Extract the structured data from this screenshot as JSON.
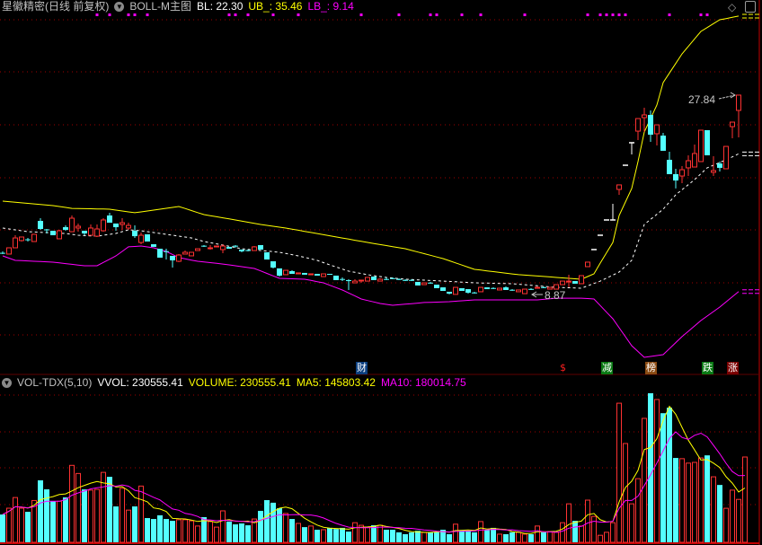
{
  "header": {
    "title": "星徽精密(日线 前复权)",
    "indicator": "BOLL-M主图",
    "bl": "BL: 22.30",
    "ub": "UB_: 35.46",
    "lb": "LB_: 9.14"
  },
  "volume_header": {
    "indicator": "VOL-TDX(5,10)",
    "vvol": "VVOL: 230555.41",
    "volume": "VOLUME: 230555.41",
    "ma5": "MA5: 145803.42",
    "ma10": "MA10: 180014.75"
  },
  "annotations": {
    "high_label": "27.84",
    "low_label": "8.87"
  },
  "icons": {
    "top_right": [
      "diamond-icon",
      "panel-toggle-icon"
    ],
    "collapse": "chevron-down-circle-icon"
  },
  "colors": {
    "up": "#ff3232",
    "down": "#54ffff",
    "flat": "#ffffff",
    "ub": "#ffff00",
    "mid": "#ffffff",
    "lb": "#ff00ff",
    "grid": "#a00000",
    "ma5": "#ffff00",
    "ma10": "#ff00ff"
  },
  "events": [
    {
      "label": "财",
      "index": 57,
      "bg": "#0b3f80",
      "fg": "#ffffff"
    },
    {
      "label": "$",
      "index": 89,
      "bg": "transparent",
      "fg": "#ff2020"
    },
    {
      "label": "减",
      "index": 96,
      "bg": "#0a7a14",
      "fg": "#ffffff"
    },
    {
      "label": "榜",
      "index": 103,
      "bg": "#8a4a12",
      "fg": "#ffffff"
    },
    {
      "label": "跌",
      "index": 112,
      "bg": "#0a7a14",
      "fg": "#ffffff"
    },
    {
      "label": "涨",
      "index": 116,
      "bg": "#7a0000",
      "fg": "#ffffff"
    }
  ],
  "chart_data": {
    "type": "candlestick",
    "candle_fields": [
      "open",
      "close",
      "high",
      "low"
    ],
    "candles": [
      [
        12.84,
        12.8,
        12.98,
        12.72
      ],
      [
        12.72,
        13.32,
        13.32,
        12.72
      ],
      [
        13.32,
        14.26,
        14.52,
        13.32
      ],
      [
        14.01,
        14.35,
        14.35,
        13.92
      ],
      [
        14.13,
        14.09,
        14.26,
        13.92
      ],
      [
        13.92,
        14.61,
        14.61,
        13.92
      ],
      [
        15.89,
        15.12,
        16.15,
        15.04
      ],
      [
        15.08,
        15.04,
        15.12,
        14.69
      ],
      [
        14.95,
        14.52,
        14.95,
        14.52
      ],
      [
        14.18,
        14.95,
        15.04,
        14.18
      ],
      [
        15.29,
        15.04,
        15.46,
        14.95
      ],
      [
        14.86,
        16.15,
        16.41,
        14.86
      ],
      [
        15.21,
        15.38,
        15.64,
        14.86
      ],
      [
        14.95,
        14.69,
        14.95,
        14.52
      ],
      [
        14.52,
        15.21,
        15.55,
        14.52
      ],
      [
        14.43,
        15.12,
        15.55,
        14.35
      ],
      [
        14.95,
        15.98,
        16.15,
        14.86
      ],
      [
        16.41,
        15.72,
        16.67,
        15.72
      ],
      [
        15.64,
        15.29,
        15.64,
        14.95
      ],
      [
        15.55,
        15.72,
        16.15,
        15.04
      ],
      [
        15.21,
        15.46,
        15.72,
        15.04
      ],
      [
        14.95,
        14.43,
        15.46,
        14.26
      ],
      [
        13.83,
        14.52,
        14.78,
        13.66
      ],
      [
        14.61,
        13.92,
        14.61,
        13.92
      ],
      [
        13.66,
        13.41,
        13.66,
        13.41
      ],
      [
        13.23,
        12.38,
        13.23,
        12.38
      ],
      [
        13.0,
        12.98,
        13.23,
        12.2
      ],
      [
        12.55,
        12.12,
        12.55,
        11.43
      ],
      [
        12.03,
        12.63,
        12.72,
        11.95
      ],
      [
        12.72,
        12.89,
        13.06,
        12.72
      ],
      [
        12.55,
        12.89,
        12.89,
        12.55
      ],
      [
        13.06,
        13.23,
        13.23,
        13.06
      ],
      [
        13.52,
        13.49,
        13.58,
        13.41
      ],
      [
        13.3,
        13.32,
        13.58,
        13.15
      ],
      [
        13.41,
        13.49,
        13.49,
        13.41
      ],
      [
        13.15,
        13.49,
        13.66,
        12.8
      ],
      [
        13.41,
        13.23,
        13.41,
        13.23
      ],
      [
        13.52,
        13.49,
        13.58,
        13.32
      ],
      [
        13.15,
        12.98,
        13.15,
        12.89
      ],
      [
        13.1,
        13.06,
        13.15,
        12.98
      ],
      [
        13.06,
        13.41,
        13.49,
        13.06
      ],
      [
        13.58,
        13.15,
        13.58,
        13.15
      ],
      [
        12.89,
        12.2,
        12.89,
        12.2
      ],
      [
        12.03,
        11.43,
        12.03,
        11.35
      ],
      [
        11.35,
        10.66,
        11.35,
        10.57
      ],
      [
        10.75,
        11.17,
        11.17,
        10.75
      ],
      [
        11.09,
        10.83,
        11.17,
        10.83
      ],
      [
        10.83,
        10.92,
        10.92,
        10.83
      ],
      [
        10.92,
        10.75,
        10.92,
        10.75
      ],
      [
        10.75,
        10.83,
        10.83,
        10.75
      ],
      [
        10.83,
        10.66,
        10.83,
        10.66
      ],
      [
        10.57,
        10.83,
        10.83,
        10.57
      ],
      [
        10.83,
        10.75,
        10.83,
        10.75
      ],
      [
        10.66,
        10.23,
        10.66,
        10.23
      ],
      [
        10.34,
        10.32,
        10.49,
        10.14
      ],
      [
        10.23,
        10.14,
        10.32,
        9.29
      ],
      [
        9.97,
        10.14,
        10.32,
        9.97
      ],
      [
        10.21,
        10.23,
        10.23,
        9.97
      ],
      [
        10.14,
        10.49,
        10.49,
        10.14
      ],
      [
        10.57,
        10.23,
        10.57,
        10.23
      ],
      [
        10.14,
        10.32,
        10.4,
        10.14
      ],
      [
        10.34,
        10.32,
        10.49,
        10.23
      ],
      [
        10.42,
        10.4,
        10.49,
        10.32
      ],
      [
        10.34,
        10.32,
        10.4,
        10.23
      ],
      [
        10.25,
        10.23,
        10.32,
        10.14
      ],
      [
        10.25,
        10.23,
        10.32,
        10.14
      ],
      [
        10.06,
        9.72,
        10.06,
        9.72
      ],
      [
        9.8,
        9.97,
        9.97,
        9.8
      ],
      [
        9.99,
        9.97,
        10.06,
        9.89
      ],
      [
        9.8,
        9.46,
        9.8,
        9.46
      ],
      [
        9.54,
        9.2,
        9.54,
        9.2
      ],
      [
        9.12,
        8.94,
        9.12,
        8.87
      ],
      [
        8.87,
        9.54,
        9.54,
        8.87
      ],
      [
        9.46,
        9.2,
        9.46,
        9.2
      ],
      [
        9.37,
        9.03,
        9.37,
        8.94
      ],
      [
        9.05,
        9.03,
        9.12,
        8.94
      ],
      [
        9.12,
        9.54,
        9.54,
        9.12
      ],
      [
        9.54,
        9.37,
        9.54,
        9.37
      ],
      [
        9.48,
        9.46,
        9.54,
        9.37
      ],
      [
        9.29,
        9.46,
        9.46,
        9.29
      ],
      [
        9.54,
        9.29,
        9.63,
        9.29
      ],
      [
        9.31,
        9.29,
        9.37,
        9.2
      ],
      [
        9.12,
        9.29,
        9.29,
        9.12
      ],
      [
        8.94,
        9.37,
        9.37,
        8.94
      ],
      [
        9.39,
        9.37,
        9.46,
        9.29
      ],
      [
        9.52,
        9.54,
        9.63,
        9.46
      ],
      [
        9.56,
        9.54,
        9.63,
        9.46
      ],
      [
        9.37,
        9.54,
        9.54,
        9.37
      ],
      [
        9.37,
        9.8,
        9.8,
        9.37
      ],
      [
        9.8,
        10.14,
        10.14,
        9.8
      ],
      [
        10.12,
        10.14,
        10.75,
        9.54
      ],
      [
        10.14,
        9.89,
        10.14,
        9.89
      ],
      [
        9.89,
        10.66,
        10.66,
        9.89
      ],
      [
        11.52,
        11.95,
        11.95,
        11.52
      ],
      [
        13.15,
        13.15,
        13.15,
        13.15
      ],
      [
        14.52,
        14.52,
        14.52,
        14.52
      ],
      [
        15.98,
        15.98,
        15.98,
        15.98
      ],
      [
        15.98,
        15.98,
        17.52,
        15.98
      ],
      [
        18.9,
        19.33,
        19.33,
        18.38
      ],
      [
        21.21,
        21.21,
        21.21,
        21.21
      ],
      [
        23.36,
        23.36,
        23.36,
        22.24
      ],
      [
        24.47,
        25.67,
        25.67,
        23.62
      ],
      [
        25.76,
        26.02,
        26.7,
        24.39
      ],
      [
        26.02,
        24.13,
        26.45,
        23.44
      ],
      [
        24.22,
        25.07,
        25.07,
        23.1
      ],
      [
        24.04,
        22.59,
        24.3,
        22.59
      ],
      [
        21.73,
        20.36,
        22.5,
        20.36
      ],
      [
        20.36,
        19.75,
        20.87,
        18.99
      ],
      [
        20.18,
        20.78,
        21.13,
        19.5
      ],
      [
        20.96,
        21.64,
        22.16,
        20.18
      ],
      [
        21.04,
        22.33,
        23.19,
        21.04
      ],
      [
        21.56,
        24.56,
        24.56,
        21.56
      ],
      [
        24.56,
        22.16,
        24.56,
        22.16
      ],
      [
        20.53,
        20.7,
        22.07,
        20.18
      ],
      [
        21.38,
        20.96,
        21.56,
        20.61
      ],
      [
        20.87,
        23.01,
        23.01,
        20.87
      ],
      [
        24.9,
        25.33,
        25.33,
        23.79
      ],
      [
        26.45,
        27.91,
        27.91,
        23.87
      ]
    ],
    "boll": {
      "ub": [
        [
          0,
          17.78
        ],
        [
          8,
          17.35
        ],
        [
          11,
          17.09
        ],
        [
          17,
          17.01
        ],
        [
          21,
          16.67
        ],
        [
          24,
          16.92
        ],
        [
          28,
          17.27
        ],
        [
          32,
          16.49
        ],
        [
          37,
          15.98
        ],
        [
          41,
          15.55
        ],
        [
          45,
          15.21
        ],
        [
          58,
          13.83
        ],
        [
          64,
          13.23
        ],
        [
          70,
          12.29
        ],
        [
          75,
          11.26
        ],
        [
          82,
          10.75
        ],
        [
          92,
          10.32
        ],
        [
          94,
          10.83
        ],
        [
          95,
          11.86
        ],
        [
          97,
          13.83
        ],
        [
          98,
          16.41
        ],
        [
          100,
          18.98
        ],
        [
          101,
          21.56
        ],
        [
          102,
          24.39
        ],
        [
          104,
          26.96
        ],
        [
          105,
          29.11
        ],
        [
          108,
          31.85
        ],
        [
          111,
          34.0
        ],
        [
          114,
          35.11
        ],
        [
          117,
          35.46
        ]
      ],
      "mid": [
        [
          0,
          15.21
        ],
        [
          4,
          14.86
        ],
        [
          10,
          14.69
        ],
        [
          12,
          14.52
        ],
        [
          15,
          14.43
        ],
        [
          18,
          14.69
        ],
        [
          20,
          15.04
        ],
        [
          22,
          14.95
        ],
        [
          27,
          14.52
        ],
        [
          30,
          14.26
        ],
        [
          32,
          13.92
        ],
        [
          35,
          13.58
        ],
        [
          38,
          13.23
        ],
        [
          41,
          13.06
        ],
        [
          44,
          12.89
        ],
        [
          47,
          12.55
        ],
        [
          50,
          12.12
        ],
        [
          52,
          11.69
        ],
        [
          55,
          11.09
        ],
        [
          58,
          10.75
        ],
        [
          61,
          10.49
        ],
        [
          64,
          10.32
        ],
        [
          70,
          10.14
        ],
        [
          75,
          9.97
        ],
        [
          81,
          9.89
        ],
        [
          88,
          9.54
        ],
        [
          92,
          9.46
        ],
        [
          95,
          10.14
        ],
        [
          98,
          11.0
        ],
        [
          100,
          12.12
        ],
        [
          101,
          13.83
        ],
        [
          102,
          15.55
        ],
        [
          105,
          17.01
        ],
        [
          107,
          18.38
        ],
        [
          110,
          19.84
        ],
        [
          112,
          20.96
        ],
        [
          115,
          21.73
        ],
        [
          117,
          22.3
        ]
      ],
      "lb": [
        [
          0,
          12.55
        ],
        [
          2,
          12.12
        ],
        [
          8,
          11.95
        ],
        [
          13,
          11.6
        ],
        [
          15,
          11.6
        ],
        [
          18,
          12.55
        ],
        [
          20,
          13.41
        ],
        [
          22,
          13.49
        ],
        [
          24,
          13.32
        ],
        [
          26,
          12.98
        ],
        [
          28,
          12.38
        ],
        [
          31,
          12.03
        ],
        [
          35,
          11.77
        ],
        [
          40,
          11.35
        ],
        [
          44,
          10.4
        ],
        [
          48,
          10.32
        ],
        [
          51,
          9.97
        ],
        [
          54,
          9.29
        ],
        [
          57,
          8.43
        ],
        [
          60,
          8.0
        ],
        [
          62,
          7.83
        ],
        [
          67,
          8.09
        ],
        [
          71,
          8.17
        ],
        [
          75,
          8.34
        ],
        [
          85,
          8.34
        ],
        [
          88,
          8.51
        ],
        [
          92,
          8.51
        ],
        [
          94,
          8.43
        ],
        [
          97,
          6.54
        ],
        [
          100,
          3.97
        ],
        [
          102,
          2.85
        ],
        [
          105,
          3.11
        ],
        [
          108,
          4.83
        ],
        [
          111,
          6.37
        ],
        [
          114,
          7.66
        ],
        [
          117,
          9.14
        ]
      ]
    },
    "volume": [
      75200,
      92200,
      121000,
      92200,
      82500,
      113000,
      167500,
      143200,
      111000,
      111000,
      121400,
      208000,
      186000,
      143000,
      141000,
      143000,
      189000,
      177000,
      97000,
      146000,
      87000,
      97000,
      152000,
      65500,
      63000,
      73000,
      63000,
      58000,
      61000,
      61000,
      58000,
      44000,
      68000,
      56000,
      41000,
      85000,
      56000,
      48500,
      51000,
      46000,
      63000,
      85000,
      114000,
      107000,
      92000,
      78000,
      63000,
      51000,
      41000,
      44000,
      34000,
      34000,
      39000,
      36000,
      39000,
      29000,
      53000,
      46000,
      41000,
      46000,
      46000,
      34000,
      34000,
      27000,
      22000,
      27000,
      31000,
      27000,
      27000,
      27000,
      34000,
      22000,
      49000,
      31000,
      31000,
      27000,
      56000,
      34000,
      39000,
      22000,
      22000,
      27000,
      27000,
      22000,
      22000,
      44000,
      27000,
      29000,
      27000,
      53000,
      104000,
      58000,
      44000,
      114000,
      70000,
      19000,
      27000,
      53000,
      376000,
      267000,
      104000,
      172000,
      335000,
      403000,
      386000,
      349000,
      364000,
      228000,
      226000,
      214000,
      216000,
      228000,
      235000,
      177000,
      155000,
      92000,
      141000,
      116000,
      230555
    ],
    "volume_ma_periods": [
      5,
      10
    ],
    "marker_indices": [
      15,
      17,
      20,
      21,
      23,
      36,
      37,
      39,
      43,
      47,
      57,
      63,
      68,
      69,
      73,
      76,
      83,
      93,
      95,
      96,
      97,
      98,
      99,
      106,
      111,
      112
    ]
  }
}
